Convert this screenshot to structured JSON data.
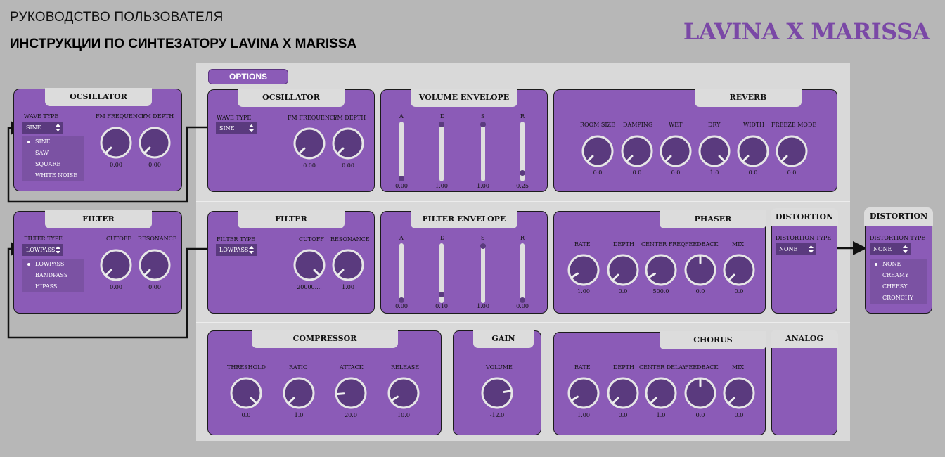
{
  "header": {
    "subtitle": "РУКОВОДСТВО ПОЛЬЗОВАТЕЛЯ",
    "title": "ИНСТРУКЦИИ ПО СИНТЕЗАТОРУ LAVINA X MARISSA",
    "brand": "LAVINA X MARISSA"
  },
  "colors": {
    "panel": "#8b5bb7",
    "knob": "#5a3a7e",
    "background": "#b7b7b7",
    "main_area": "#d9d9d9"
  },
  "options_label": "OPTIONS",
  "callouts": {
    "oscillator": {
      "title": "OCSILLATOR",
      "wave_type_label": "WAVE TYPE",
      "wave_type_value": "SINE",
      "options": [
        "SINE",
        "SAW",
        "SQUARE",
        "WHITE NOISE"
      ],
      "knobs": [
        {
          "label": "FM FREQUENCY",
          "value": "0.00",
          "level": 0.0
        },
        {
          "label": "FM DEPTH",
          "value": "0.00",
          "level": 0.0
        }
      ]
    },
    "filter": {
      "title": "FILTER",
      "filter_type_label": "FILTER TYPE",
      "filter_type_value": "LOWPASS",
      "options": [
        "LOWPASS",
        "BANDPASS",
        "HIPASS"
      ],
      "knobs": [
        {
          "label": "CUTOFF",
          "value": "0.00",
          "level": 0.0
        },
        {
          "label": "RESONANCE",
          "value": "0.00",
          "level": 0.0
        }
      ]
    },
    "distortion": {
      "title": "DISTORTION",
      "type_label": "DISTORTION TYPE",
      "type_value": "NONE",
      "options": [
        "NONE",
        "CREAMY",
        "CHEESY",
        "CRONCHY"
      ]
    }
  },
  "panels": {
    "oscillator": {
      "title": "OCSILLATOR",
      "wave_type_label": "WAVE TYPE",
      "wave_type_value": "SINE",
      "knobs": [
        {
          "label": "FM FREQUENCY",
          "value": "0.00",
          "level": 0.0
        },
        {
          "label": "FM DEPTH",
          "value": "0.00",
          "level": 0.0
        }
      ]
    },
    "volume_envelope": {
      "title": "VOLUME ENVELOPE",
      "sliders": [
        {
          "label": "A",
          "value": "0.00",
          "level": 0.0
        },
        {
          "label": "D",
          "value": "1.00",
          "level": 1.0
        },
        {
          "label": "S",
          "value": "1.00",
          "level": 1.0
        },
        {
          "label": "R",
          "value": "0.25",
          "level": 0.1
        }
      ]
    },
    "reverb": {
      "title": "REVERB",
      "knobs": [
        {
          "label": "ROOM SIZE",
          "value": "0.0",
          "level": 0.0
        },
        {
          "label": "DAMPING",
          "value": "0.0",
          "level": 0.0
        },
        {
          "label": "WET",
          "value": "0.0",
          "level": 0.0
        },
        {
          "label": "DRY",
          "value": "1.0",
          "level": 1.0
        },
        {
          "label": "WIDTH",
          "value": "0.0",
          "level": 0.0
        },
        {
          "label": "FREEZE MODE",
          "value": "0.0",
          "level": 0.0
        }
      ]
    },
    "filter": {
      "title": "FILTER",
      "filter_type_label": "FILTER TYPE",
      "filter_type_value": "LOWPASS",
      "knobs": [
        {
          "label": "CUTOFF",
          "value": "20000....",
          "level": 1.0
        },
        {
          "label": "RESONANCE",
          "value": "1.00",
          "level": 0.0
        }
      ]
    },
    "filter_envelope": {
      "title": "FILTER ENVELOPE",
      "sliders": [
        {
          "label": "A",
          "value": "0.00",
          "level": 0.0
        },
        {
          "label": "D",
          "value": "0.10",
          "level": 0.1
        },
        {
          "label": "S",
          "value": "1.00",
          "level": 1.0
        },
        {
          "label": "R",
          "value": "0.00",
          "level": 0.0
        }
      ]
    },
    "phaser": {
      "title": "PHASER",
      "knobs": [
        {
          "label": "RATE",
          "value": "1.00",
          "level": 0.05
        },
        {
          "label": "DEPTH",
          "value": "0.0",
          "level": 0.0
        },
        {
          "label": "CENTER FREQ",
          "value": "500.0",
          "level": 0.05
        },
        {
          "label": "FEEDBACK",
          "value": "0.0",
          "level": 0.5
        },
        {
          "label": "MIX",
          "value": "0.0",
          "level": 0.0
        }
      ]
    },
    "distortion": {
      "title": "DISTORTION",
      "type_label": "DISTORTION TYPE",
      "type_value": "NONE"
    },
    "compressor": {
      "title": "COMPRESSOR",
      "knobs": [
        {
          "label": "THRESHOLD",
          "value": "0.0",
          "level": 1.0
        },
        {
          "label": "RATIO",
          "value": "1.0",
          "level": 0.0
        },
        {
          "label": "ATTACK",
          "value": "20.0",
          "level": 0.15
        },
        {
          "label": "RELEASE",
          "value": "10.0",
          "level": 0.05
        }
      ]
    },
    "gain": {
      "title": "GAIN",
      "knobs": [
        {
          "label": "VOLUME",
          "value": "-12.0",
          "level": 0.8
        }
      ]
    },
    "chorus": {
      "title": "CHORUS",
      "knobs": [
        {
          "label": "RATE",
          "value": "1.00",
          "level": 0.05
        },
        {
          "label": "DEPTH",
          "value": "0.0",
          "level": 0.0
        },
        {
          "label": "CENTER DELAY",
          "value": "1.0",
          "level": 0.0
        },
        {
          "label": "FEEDBACK",
          "value": "0.0",
          "level": 0.5
        },
        {
          "label": "MIX",
          "value": "0.0",
          "level": 0.0
        }
      ]
    },
    "analog": {
      "title": "ANALOG"
    }
  }
}
